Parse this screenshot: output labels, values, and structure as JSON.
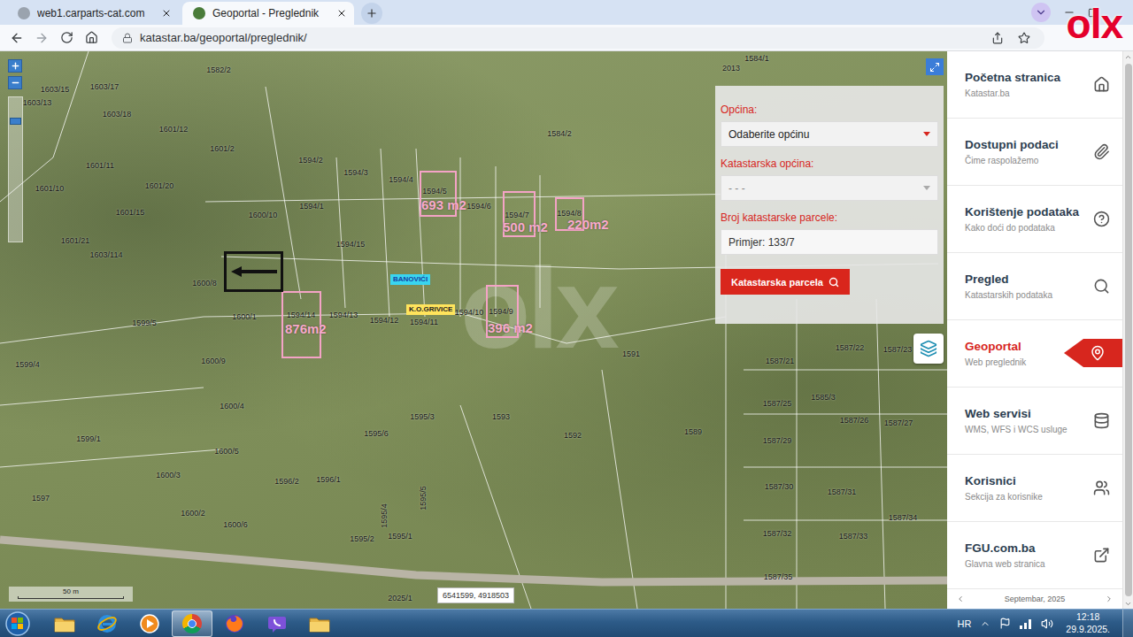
{
  "browser": {
    "tabs": [
      {
        "title": "web1.carparts-cat.com",
        "selected": false
      },
      {
        "title": "Geoportal - Preglednik",
        "selected": true
      }
    ],
    "url": "katastar.ba/geoportal/preglednik/"
  },
  "overlay_logo": "olx",
  "map": {
    "parcels": [
      "1582/2",
      "1584/1",
      "2013",
      "1603/15",
      "1603/17",
      "1603/13",
      "1603/18",
      "1601/12",
      "1601/2",
      "1601/11",
      "1601/20",
      "1601/10",
      "1601/15",
      "1601/21",
      "1603/114",
      "1600/10",
      "1600/8",
      "1600/1",
      "1599/5",
      "1599/4",
      "1600/9",
      "1600/4",
      "1600/5",
      "1599/1",
      "1600/3",
      "1597",
      "1600/2",
      "1600/6",
      "1596/2",
      "1596/1",
      "1595/2",
      "1595/1",
      "1595/6",
      "1595/3",
      "1595/5",
      "1595/4",
      "1594/2",
      "1594/3",
      "1594/4",
      "1594/5",
      "1594/6",
      "1594/1",
      "1594/7",
      "1594/8",
      "1584/2",
      "1594/15",
      "1594/14",
      "1594/13",
      "1594/12",
      "1594/11",
      "1594/10",
      "1594/9",
      "1593",
      "1592",
      "1591",
      "1589",
      "1587/21",
      "1587/22",
      "1587/23",
      "1585/3",
      "1587/25",
      "1587/26",
      "1587/27",
      "1587/29",
      "1587/30",
      "1587/31",
      "1587/34",
      "1587/32",
      "1587/33",
      "1587/35",
      "2025/1"
    ],
    "place_labels": [
      {
        "text": "BANOVIĆI",
        "color": "#39d5f0"
      },
      {
        "text": "K.O.GRIVICE",
        "color": "#ffe45c"
      }
    ],
    "annotations": [
      {
        "area": "693 m2"
      },
      {
        "area": "500 m2"
      },
      {
        "area": "220m2"
      },
      {
        "area": "876m2"
      },
      {
        "area": "396 m2"
      }
    ],
    "zoom_slider": {
      "level": 0.85
    },
    "scale": "50 m",
    "coordinates": "6541599, 4918503",
    "watermark": "olx"
  },
  "search_panel": {
    "fields": [
      {
        "label": "Općina:",
        "kind": "select",
        "value": "Odaberite općinu",
        "disabled": false
      },
      {
        "label": "Katastarska općina:",
        "kind": "select",
        "value": "- - -",
        "disabled": true
      },
      {
        "label": "Broj katastarske parcele:",
        "kind": "input",
        "placeholder": "Primjer: 133/7"
      }
    ],
    "button": "Katastarska parcela"
  },
  "sidebar": {
    "items": [
      {
        "title": "Početna stranica",
        "subtitle": "Katastar.ba",
        "selected": false
      },
      {
        "title": "Dostupni podaci",
        "subtitle": "Čime raspolažemo",
        "selected": false
      },
      {
        "title": "Korištenje podataka",
        "subtitle": "Kako doći do podataka",
        "selected": false
      },
      {
        "title": "Pregled",
        "subtitle": "Katastarskih podataka",
        "selected": false
      },
      {
        "title": "Geoportal",
        "subtitle": "Web preglednik",
        "selected": true
      },
      {
        "title": "Web servisi",
        "subtitle": "WMS, WFS i WCS usluge",
        "selected": false
      },
      {
        "title": "Korisnici",
        "subtitle": "Sekcija za korisnike",
        "selected": false
      },
      {
        "title": "FGU.com.ba",
        "subtitle": "Glavna web stranica",
        "selected": false
      }
    ],
    "footer": "Septembar, 2025"
  },
  "taskbar": {
    "apps": [
      {
        "kind": "explorer",
        "active": false
      },
      {
        "kind": "ie",
        "active": false
      },
      {
        "kind": "media",
        "active": false
      },
      {
        "kind": "chrome",
        "active": true
      },
      {
        "kind": "firefox",
        "active": false
      },
      {
        "kind": "viber",
        "active": false
      },
      {
        "kind": "folder",
        "active": false
      }
    ],
    "language": "HR",
    "time": "12:18",
    "date": "29.9.2025."
  }
}
